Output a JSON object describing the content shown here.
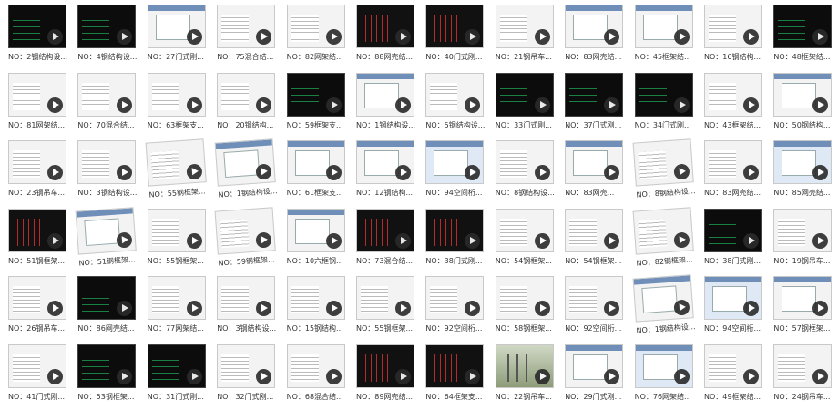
{
  "videos": [
    {
      "caption": "NO：2钢结构设...",
      "style": "dark"
    },
    {
      "caption": "NO：4钢结构设...",
      "style": "dark"
    },
    {
      "caption": "NO：27门式刚...",
      "style": "win"
    },
    {
      "caption": "NO：75混合结...",
      "style": "doc"
    },
    {
      "caption": "NO：82网架结...",
      "style": "doc"
    },
    {
      "caption": "NO：88网壳结...",
      "style": "cad"
    },
    {
      "caption": "NO：40门式刚...",
      "style": "cad"
    },
    {
      "caption": "NO：21钢吊车...",
      "style": "doc"
    },
    {
      "caption": "NO：83网壳结...",
      "style": "win"
    },
    {
      "caption": "NO：45框架结...",
      "style": "win"
    },
    {
      "caption": "NO：16钢结构...",
      "style": "doc"
    },
    {
      "caption": "NO：48框架结...",
      "style": "dark"
    },
    {
      "caption": "NO：81网架结...",
      "style": "doc"
    },
    {
      "caption": "NO：70混合结...",
      "style": "doc"
    },
    {
      "caption": "NO：63框架支...",
      "style": "doc"
    },
    {
      "caption": "NO：20钢结构...",
      "style": "doc"
    },
    {
      "caption": "NO：59框架支...",
      "style": "dark"
    },
    {
      "caption": "NO：1钢结构设...",
      "style": "win"
    },
    {
      "caption": "NO：5钢结构设...",
      "style": "doc"
    },
    {
      "caption": "NO：33门式刚...",
      "style": "dark"
    },
    {
      "caption": "NO：37门式刚...",
      "style": "dark"
    },
    {
      "caption": "NO：34门式刚...",
      "style": "dark"
    },
    {
      "caption": "NO：43框架结...",
      "style": "doc"
    },
    {
      "caption": "NO：50钢结构...",
      "style": "win"
    },
    {
      "caption": "NO：23钢吊车...",
      "style": "doc"
    },
    {
      "caption": "NO：3钢结构设...",
      "style": "doc"
    },
    {
      "caption": "NO：55钢框架...",
      "style": "doc",
      "slant": true
    },
    {
      "caption": "NO：1钢结构设...",
      "style": "win",
      "slant": true
    },
    {
      "caption": "NO：61框架支...",
      "style": "win"
    },
    {
      "caption": "NO：12钢结构...",
      "style": "win"
    },
    {
      "caption": "NO：94空间桁...",
      "style": "blue"
    },
    {
      "caption": "NO：8钢结构设...",
      "style": "doc"
    },
    {
      "caption": "NO：83网壳...",
      "style": "win"
    },
    {
      "caption": "NO：8钢结构设...",
      "style": "doc",
      "slant": true
    },
    {
      "caption": "NO：83网壳结...",
      "style": "doc"
    },
    {
      "caption": "NO：85网壳结...",
      "style": "blue"
    },
    {
      "caption": "NO：51钢框架...",
      "style": "cad"
    },
    {
      "caption": "NO：51钢框架...",
      "style": "win",
      "slant": true
    },
    {
      "caption": "NO：55钢框架...",
      "style": "doc"
    },
    {
      "caption": "NO：59钢框架...",
      "style": "doc",
      "slant": true
    },
    {
      "caption": "NO：10六框钢...",
      "style": "win"
    },
    {
      "caption": "NO：73混合结...",
      "style": "cad"
    },
    {
      "caption": "NO：38门式刚...",
      "style": "cad"
    },
    {
      "caption": "NO：54钢框架...",
      "style": "doc"
    },
    {
      "caption": "NO：54钢框架...",
      "style": "doc"
    },
    {
      "caption": "NO：82钢框架...",
      "style": "doc",
      "slant": true
    },
    {
      "caption": "NO：38门式刚...",
      "style": "dark"
    },
    {
      "caption": "NO：19钢吊车...",
      "style": "doc"
    },
    {
      "caption": "NO：26钢吊车...",
      "style": "doc"
    },
    {
      "caption": "NO：86网壳结...",
      "style": "dark"
    },
    {
      "caption": "NO：77网架结...",
      "style": "doc"
    },
    {
      "caption": "NO：3钢结构设...",
      "style": "doc"
    },
    {
      "caption": "NO：15钢结构...",
      "style": "doc"
    },
    {
      "caption": "NO：55钢框架...",
      "style": "doc"
    },
    {
      "caption": "NO：92空间桁...",
      "style": "doc"
    },
    {
      "caption": "NO：58钢框架...",
      "style": "doc"
    },
    {
      "caption": "NO：92空间桁...",
      "style": "doc"
    },
    {
      "caption": "NO：1钢结构设...",
      "style": "win",
      "slant": true
    },
    {
      "caption": "NO：94空间桁...",
      "style": "blue"
    },
    {
      "caption": "NO：57钢框架...",
      "style": "win"
    },
    {
      "caption": "NO：41门式刚...",
      "style": "doc"
    },
    {
      "caption": "NO：53钢框架...",
      "style": "dark"
    },
    {
      "caption": "NO：31门式刚...",
      "style": "dark"
    },
    {
      "caption": "NO：32门式刚...",
      "style": "doc"
    },
    {
      "caption": "NO：68混合结...",
      "style": "doc"
    },
    {
      "caption": "NO：89网壳结...",
      "style": "cad"
    },
    {
      "caption": "NO：64框架支...",
      "style": "cad"
    },
    {
      "caption": "NO：22钢吊车...",
      "style": "photo"
    },
    {
      "caption": "NO：29门式刚...",
      "style": "win"
    },
    {
      "caption": "NO：76网架结...",
      "style": "blue"
    },
    {
      "caption": "NO：49框架结...",
      "style": "doc"
    },
    {
      "caption": "NO：24钢吊车...",
      "style": "doc"
    }
  ]
}
